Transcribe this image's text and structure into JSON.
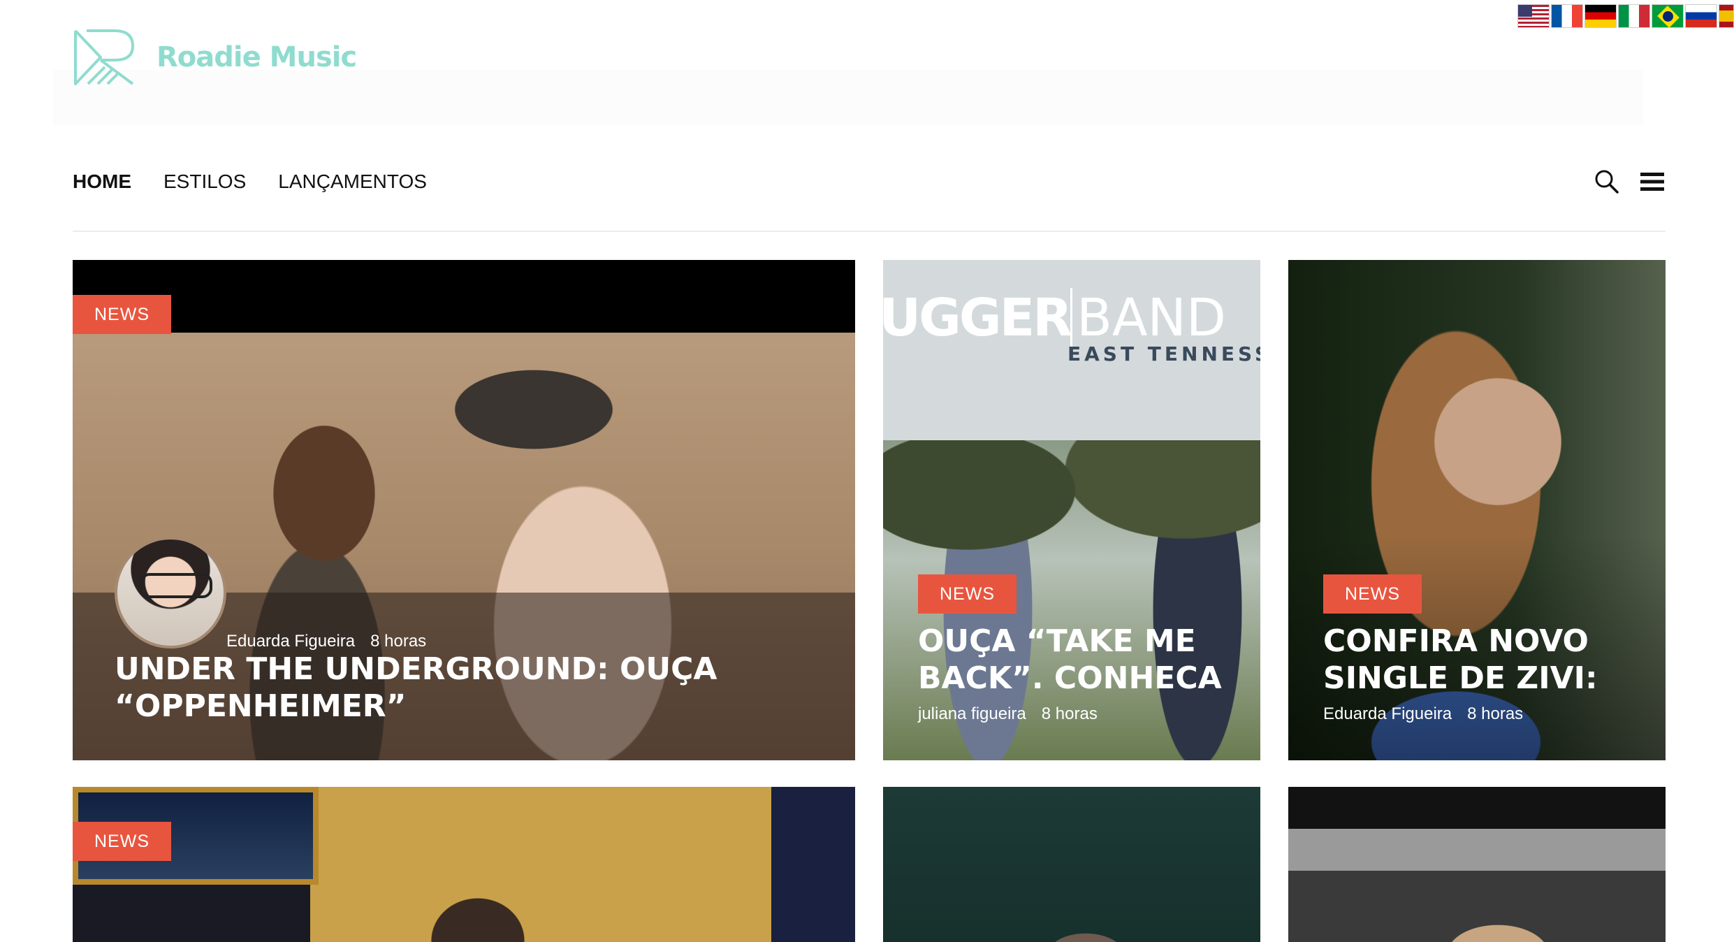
{
  "brand": {
    "name": "Roadie Music",
    "accent": "#8fdccf"
  },
  "languages": [
    "english-flag",
    "french-flag",
    "german-flag",
    "italian-flag",
    "brazilian-flag",
    "russian-flag",
    "spanish-flag"
  ],
  "nav": {
    "items": [
      {
        "label": "HOME",
        "active": true
      },
      {
        "label": "ESTILOS",
        "active": false
      },
      {
        "label": "LANÇAMENTOS",
        "active": false
      }
    ],
    "icons": [
      "search-icon",
      "menu-icon"
    ]
  },
  "badge_color": "#e8553f",
  "cards": [
    {
      "badge": "NEWS",
      "author": "Eduarda Figueira",
      "time": "8 horas",
      "title": "UNDER THE UNDERGROUND: OUÇA “OPPENHEIMER”"
    },
    {
      "badge": "NEWS",
      "author": "juliana figueira",
      "time": "8 horas",
      "title": "OUÇA “TAKE ME BACK”. CONHECA",
      "image_text": {
        "band_bold": "UGGER",
        "band_light": "BAND",
        "subtitle": "EAST TENNESSEE S"
      }
    },
    {
      "badge": "NEWS",
      "author": "Eduarda Figueira",
      "time": "8 horas",
      "title": "CONFIRA NOVO SINGLE DE ZIVI:"
    },
    {
      "badge": "NEWS"
    }
  ]
}
